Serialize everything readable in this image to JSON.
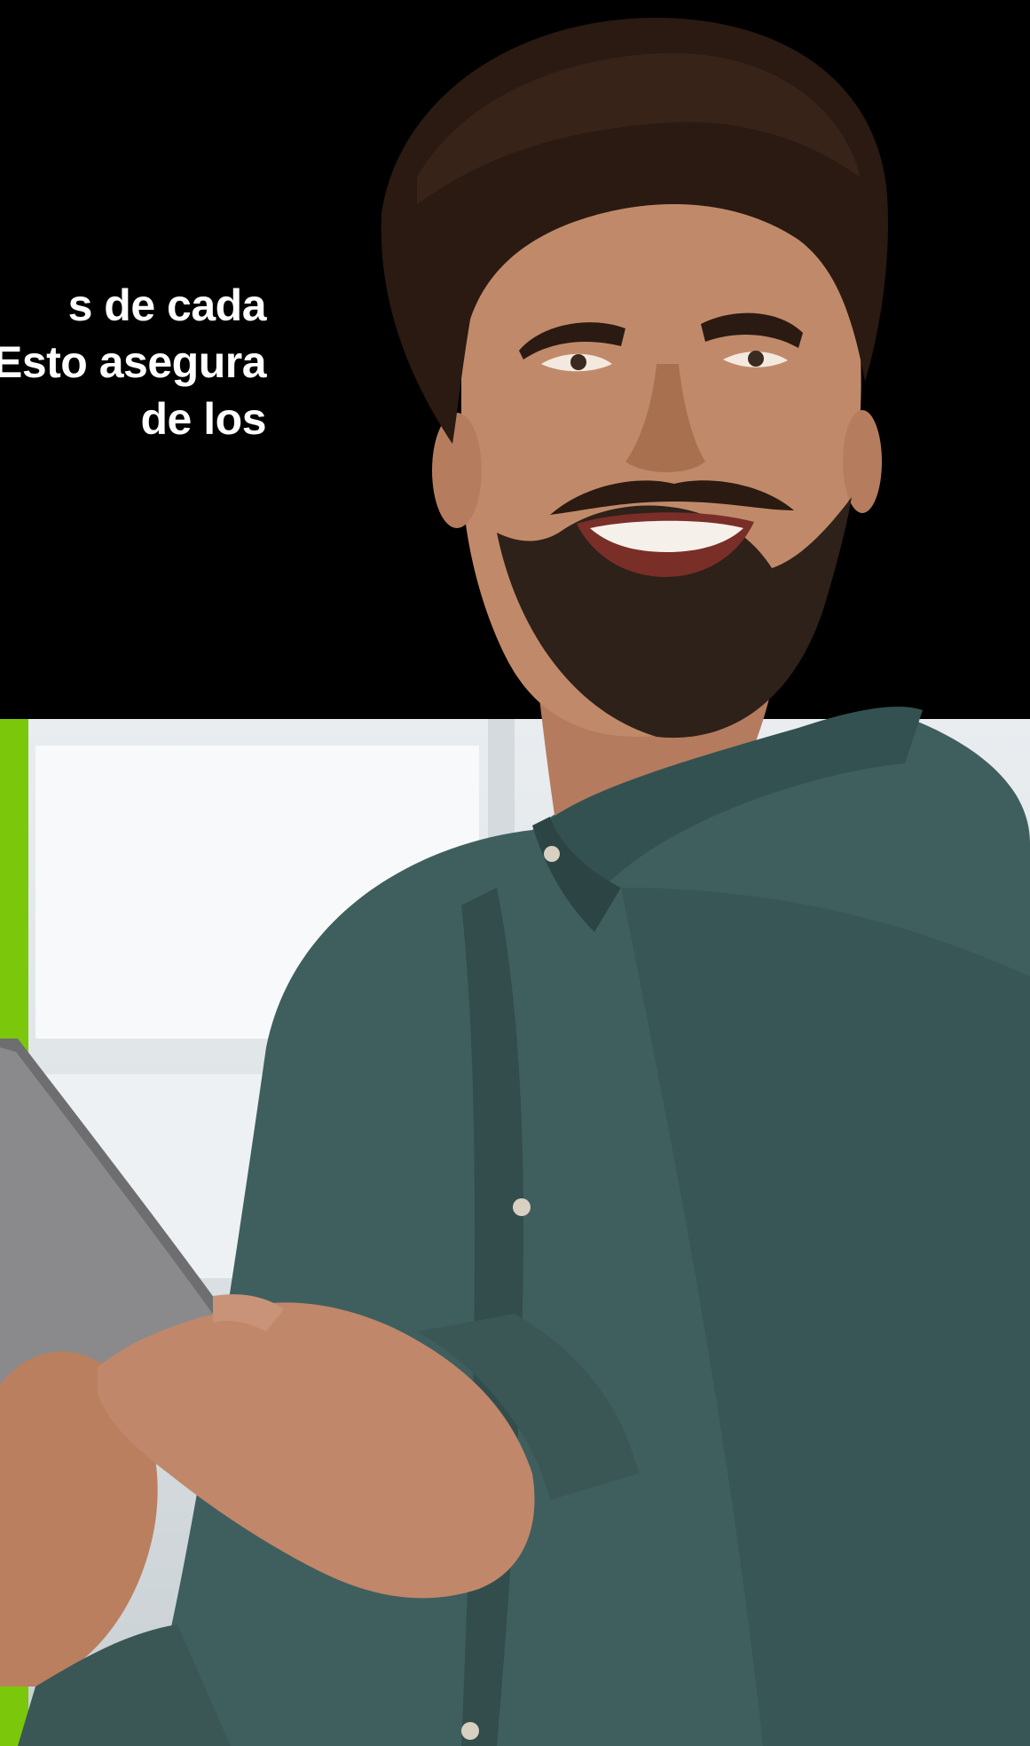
{
  "headline": {
    "lines": [
      "s de cada",
      "Esto asegura",
      "de los"
    ]
  },
  "colors": {
    "background": "#000000",
    "accent_green": "#7ac70c",
    "shirt": "#3f5f5e",
    "text": "#ffffff"
  },
  "photo": {
    "icon": "person-with-tablet-photo"
  }
}
